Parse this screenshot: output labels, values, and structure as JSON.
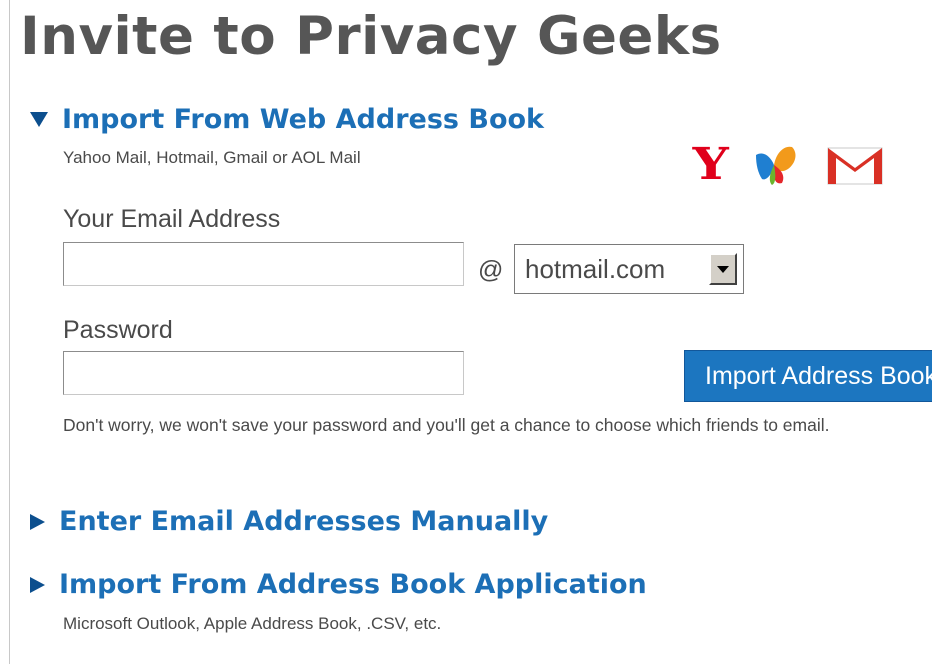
{
  "page": {
    "title": "Invite to Privacy Geeks"
  },
  "web_import": {
    "header": "Import From Web Address Book",
    "subtitle": "Yahoo Mail, Hotmail, Gmail or AOL Mail",
    "email_label": "Your Email Address",
    "email_value": "",
    "at_sign": "@",
    "domain_selected": "hotmail.com",
    "password_label": "Password",
    "password_value": "",
    "import_button": "Import Address Book",
    "notice": "Don't worry, we won't save your password and you'll get a chance to choose which friends to email.",
    "logos": {
      "yahoo": {
        "glyph": "Y",
        "icon": "yahoo-logo-icon",
        "color": "#e0001b"
      },
      "msn": {
        "icon": "msn-butterfly-icon"
      },
      "gmail": {
        "icon": "gmail-envelope-icon",
        "color": "#d93025"
      }
    }
  },
  "manual": {
    "header": "Enter Email Addresses Manually"
  },
  "app_import": {
    "header": "Import From Address Book Application",
    "subtitle": "Microsoft Outlook, Apple Address Book, .CSV, etc."
  },
  "colors": {
    "section_header": "#1c6fb6",
    "button_bg": "#1c76c0",
    "title": "#565656"
  }
}
